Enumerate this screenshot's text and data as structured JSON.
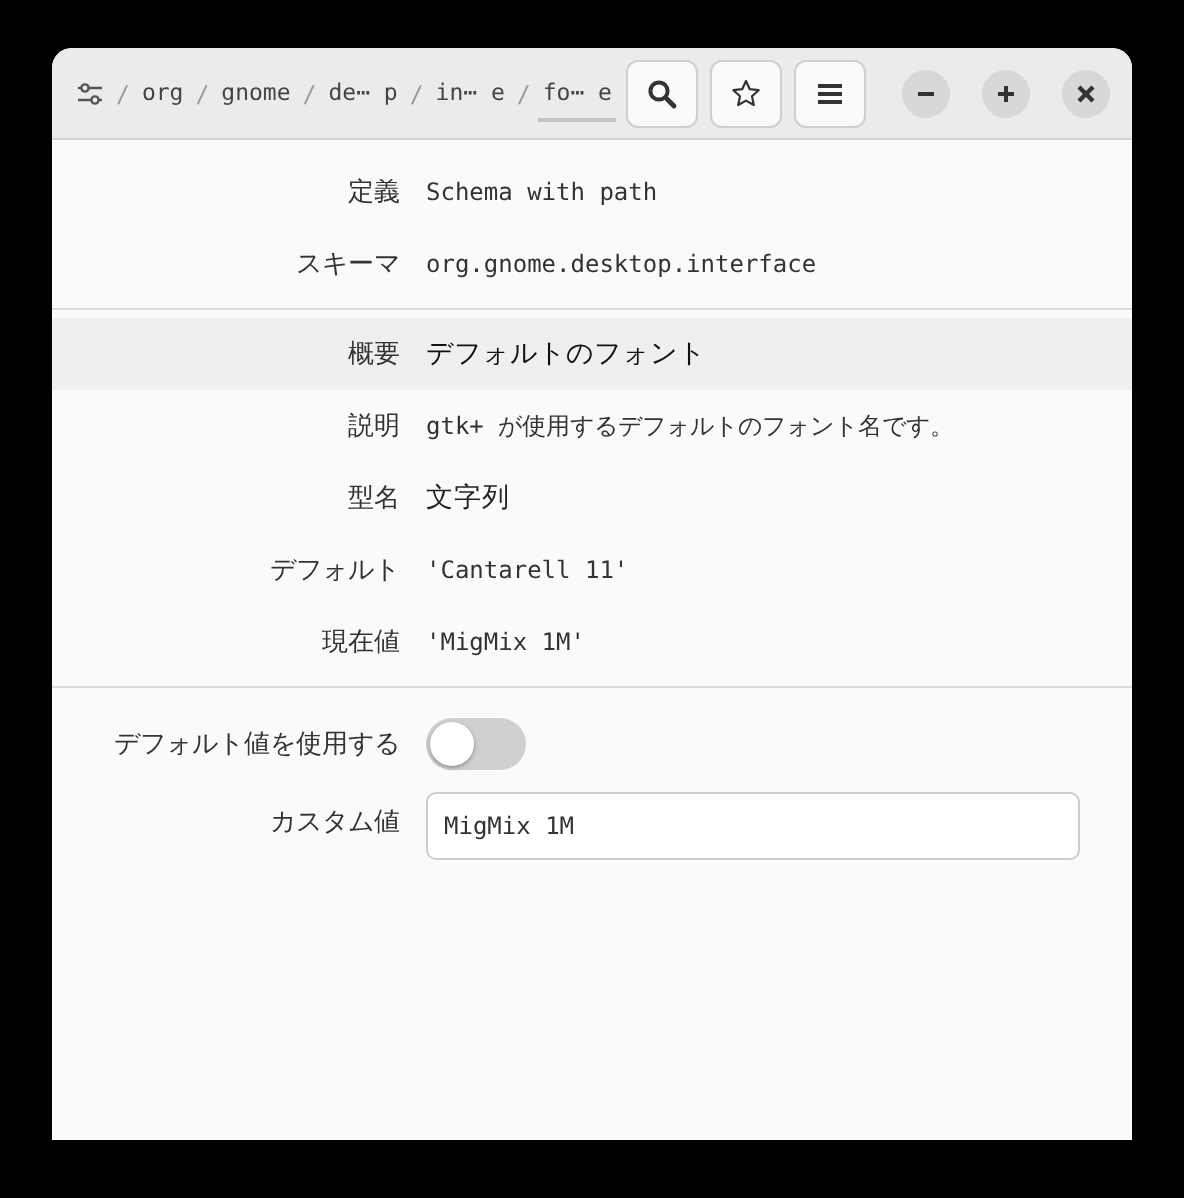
{
  "header": {
    "path": [
      {
        "text": "org",
        "selected": false
      },
      {
        "text": "gnome",
        "selected": false
      },
      {
        "text": "de⋯ p",
        "selected": false
      },
      {
        "text": "in⋯ e",
        "selected": false
      },
      {
        "text": "fo⋯ e",
        "selected": true
      }
    ],
    "separator": "/"
  },
  "sections": [
    [
      {
        "kind": "code",
        "label": "定義",
        "value": "Schema with path",
        "highlighted": false
      },
      {
        "kind": "code",
        "label": "スキーマ",
        "value": "org.gnome.desktop.interface",
        "highlighted": false
      }
    ],
    [
      {
        "kind": "text",
        "label": "概要",
        "value": "デフォルトのフォント",
        "highlighted": true
      },
      {
        "kind": "code",
        "label": "説明",
        "value": "gtk+ が使用するデフォルトのフォント名です。",
        "highlighted": false
      },
      {
        "kind": "text",
        "label": "型名",
        "value": "文字列",
        "highlighted": false
      },
      {
        "kind": "code",
        "label": "デフォルト",
        "value": "'Cantarell 11'",
        "highlighted": false
      },
      {
        "kind": "code",
        "label": "現在値",
        "value": "'MigMix 1M'",
        "highlighted": false
      }
    ],
    [
      {
        "kind": "switch",
        "label": "デフォルト値を使用する",
        "on": false
      },
      {
        "kind": "entry",
        "label": "カスタム値",
        "value": "MigMix 1M"
      }
    ]
  ]
}
